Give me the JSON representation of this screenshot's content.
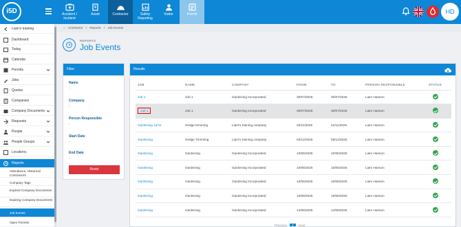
{
  "app": {
    "logo": "i5D",
    "user_initials": "HD"
  },
  "colors": {
    "brand": "#0d87d6",
    "danger": "#d9363e",
    "success": "#2ea44f",
    "highlight_border": "#e00000"
  },
  "nav": [
    {
      "label_line1": "Accident /",
      "label_line2": "Incident",
      "icon": "accident-icon"
    },
    {
      "label_line1": "Asset",
      "label_line2": "",
      "icon": "asset-icon"
    },
    {
      "label_line1": "Contractor",
      "label_line2": "",
      "icon": "contractor-icon"
    },
    {
      "label_line1": "Safety",
      "label_line2": "Reporting",
      "icon": "safety-reporting-icon"
    },
    {
      "label_line1": "Visitor",
      "label_line2": "",
      "icon": "visitor-icon"
    },
    {
      "label_line1": "Permit",
      "label_line2": "",
      "icon": "permit-icon"
    }
  ],
  "sidebar": {
    "items": [
      {
        "label": "Liam's training"
      },
      {
        "label": "Dashboard"
      },
      {
        "label": "Today"
      },
      {
        "label": "Calendar"
      },
      {
        "label": "Permits"
      },
      {
        "label": "Jobs"
      },
      {
        "label": "Quotes"
      },
      {
        "label": "Companies"
      },
      {
        "label": "Company Documents"
      },
      {
        "label": "Requests"
      },
      {
        "label": "People"
      },
      {
        "label": "People Groups"
      },
      {
        "label": "Locations"
      },
      {
        "label": "Reports"
      }
    ],
    "sub_items": [
      {
        "label": "Attendance, Historical Contractors"
      },
      {
        "label": "Company Tags"
      },
      {
        "label": "Expired Company Documents"
      },
      {
        "label": "Expiring Company Documents"
      },
      {
        "label": "Job Events"
      },
      {
        "label": "Open Permits"
      }
    ]
  },
  "breadcrumb": [
    "Contractor",
    "/",
    "Reports",
    "/",
    "Job Events"
  ],
  "header": {
    "subtitle": "REPORTS",
    "title": "Job Events"
  },
  "filter": {
    "title": "Filter",
    "fields": [
      {
        "label": "Name",
        "value": "-"
      },
      {
        "label": "Company",
        "value": "-"
      },
      {
        "label": "Person Responsible",
        "value": "-"
      },
      {
        "label": "Start Date",
        "value": "-"
      },
      {
        "label": "End Date",
        "value": "-"
      }
    ],
    "reset_label": "Reset"
  },
  "results": {
    "title": "Results",
    "columns": [
      "JOB",
      "NAME",
      "COMPANY",
      "FROM",
      "TO",
      "PERSON RESPONSIBLE",
      "STATUS"
    ],
    "rows": [
      {
        "job": "Job 1",
        "name": "Job 1",
        "company": "Gardening Incorporated",
        "from": "30/07/2025",
        "to": "30/07/2025",
        "person": "Liam Hanson"
      },
      {
        "job": "Job 1",
        "name": "Job 1",
        "company": "Gardening Incorporated",
        "from": "30/07/2025",
        "to": "30/07/2025",
        "person": "Liam Hanson"
      },
      {
        "job": "Gardening 14/11",
        "name": "Hedge trimming",
        "company": "Liam's training company",
        "from": "20/11/2025",
        "to": "21/11/2025",
        "person": "Liam Hanson"
      },
      {
        "job": "Gardening",
        "name": "Hedge Trimming",
        "company": "Liam's training company",
        "from": "03/12/2025",
        "to": "05/12/2025",
        "person": "Liam Hanson"
      },
      {
        "job": "Gardening",
        "name": "Gardening",
        "company": "Gardening Incorporated",
        "from": "10/06/2025",
        "to": "10/06/2025",
        "person": "Liam Hanson"
      },
      {
        "job": "Gardening",
        "name": "Gardening",
        "company": "Gardening Incorporated",
        "from": "10/06/2025",
        "to": "10/06/2025",
        "person": "Liam Hanson"
      },
      {
        "job": "Gardening",
        "name": "Gardening",
        "company": "Gardening Incorporated",
        "from": "10/06/2025",
        "to": "10/06/2025",
        "person": "Liam Hanson"
      },
      {
        "job": "Gardening",
        "name": "Gardening",
        "company": "Gardening Incorporated",
        "from": "10/06/2025",
        "to": "10/06/2025",
        "person": "Liam Hanson"
      },
      {
        "job": "Gardening",
        "name": "Gardening",
        "company": "Gardening Incorporated",
        "from": "14/06/2025",
        "to": "14/06/2025",
        "person": "Liam Hanson"
      }
    ],
    "pager": {
      "prev": "Previous",
      "page": "1",
      "next": "Next"
    }
  }
}
